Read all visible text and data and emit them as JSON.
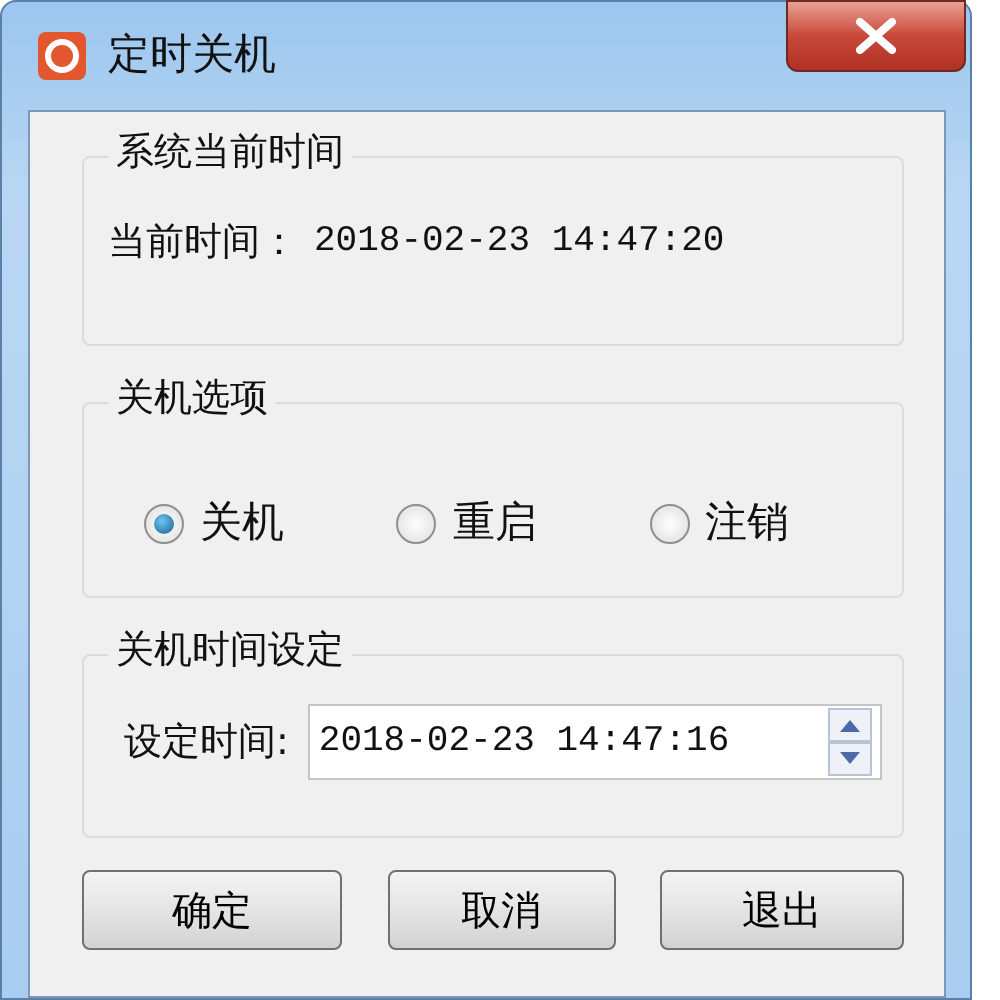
{
  "window": {
    "title": "定时关机"
  },
  "current_time_group": {
    "legend": "系统当前时间",
    "label": "当前时间：",
    "value": "2018-02-23 14:47:20"
  },
  "options_group": {
    "legend": "关机选项",
    "options": [
      {
        "label": "关机",
        "selected": true
      },
      {
        "label": "重启",
        "selected": false
      },
      {
        "label": "注销",
        "selected": false
      }
    ]
  },
  "set_time_group": {
    "legend": "关机时间设定",
    "label": "设定时间:",
    "value": "2018-02-23 14:47:16"
  },
  "buttons": [
    "确定",
    "取消",
    "退出"
  ]
}
